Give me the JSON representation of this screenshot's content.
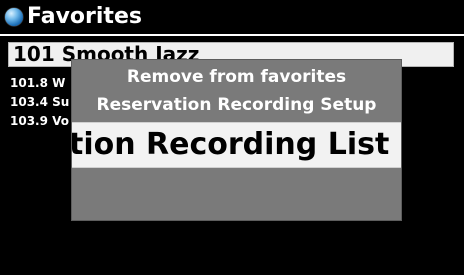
{
  "header": {
    "icon": "globe-icon",
    "title": "Favorites"
  },
  "favorites": {
    "items": [
      {
        "label": "101 Smooth Jazz",
        "selected": true
      },
      {
        "label": "101.8 W",
        "selected": false
      },
      {
        "label": "103.4 Su",
        "selected": false
      },
      {
        "label": "103.9 Vo",
        "selected": false
      }
    ]
  },
  "popup_menu": {
    "items": [
      {
        "label": "Remove from favorites"
      },
      {
        "label": "Reservation Recording Setup"
      },
      {
        "label": "tion Recording List",
        "selected": true
      }
    ]
  },
  "colors": {
    "background": "#000000",
    "text": "#ffffff",
    "selected_bg": "#f0f0f0",
    "popup_bg": "#7a7a7a"
  }
}
